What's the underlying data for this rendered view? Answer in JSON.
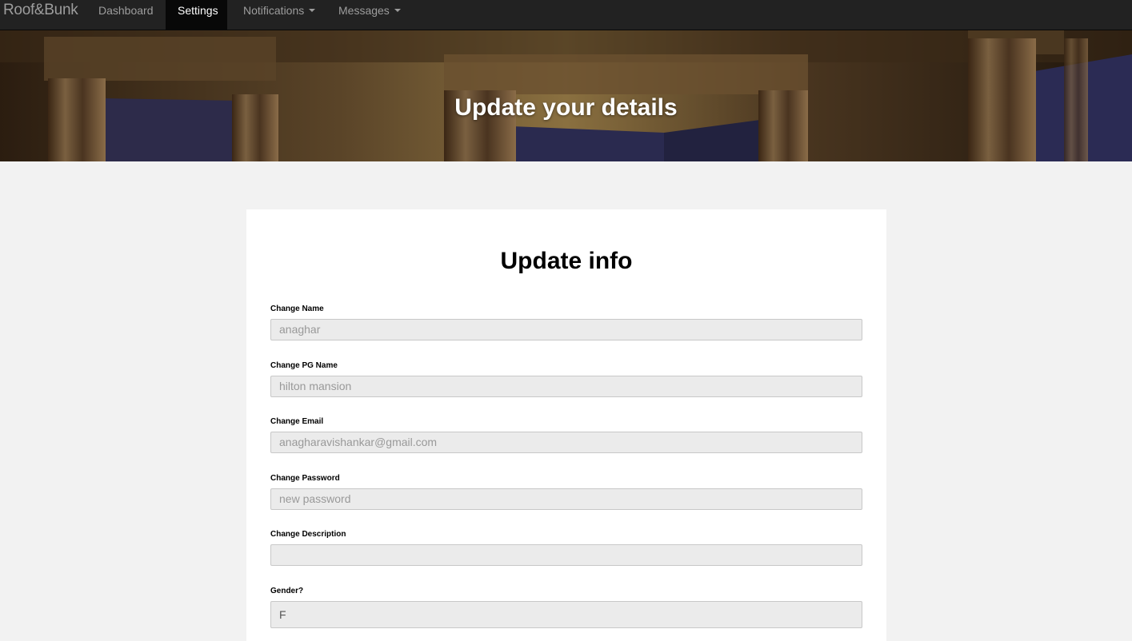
{
  "navbar": {
    "brand": "Roof&Bunk",
    "items": [
      {
        "label": "Dashboard",
        "active": false,
        "dropdown": false
      },
      {
        "label": "Settings",
        "active": true,
        "dropdown": false
      },
      {
        "label": "Notifications",
        "active": false,
        "dropdown": true
      },
      {
        "label": "Messages",
        "active": false,
        "dropdown": true
      }
    ]
  },
  "hero": {
    "title": "Update your details"
  },
  "form": {
    "title": "Update info",
    "fields": [
      {
        "label": "Change Name",
        "placeholder": "anaghar"
      },
      {
        "label": "Change PG Name",
        "placeholder": "hilton mansion"
      },
      {
        "label": "Change Email",
        "placeholder": "anagharavishankar@gmail.com"
      },
      {
        "label": "Change Password",
        "placeholder": "new password"
      },
      {
        "label": "Change Description",
        "placeholder": ""
      },
      {
        "label": "Gender?",
        "value": "F"
      }
    ]
  },
  "colors": {
    "navbar_bg": "#222222",
    "active_tab_bg": "#080808",
    "page_bg": "#f2f2f2",
    "input_bg": "#ebebeb"
  }
}
